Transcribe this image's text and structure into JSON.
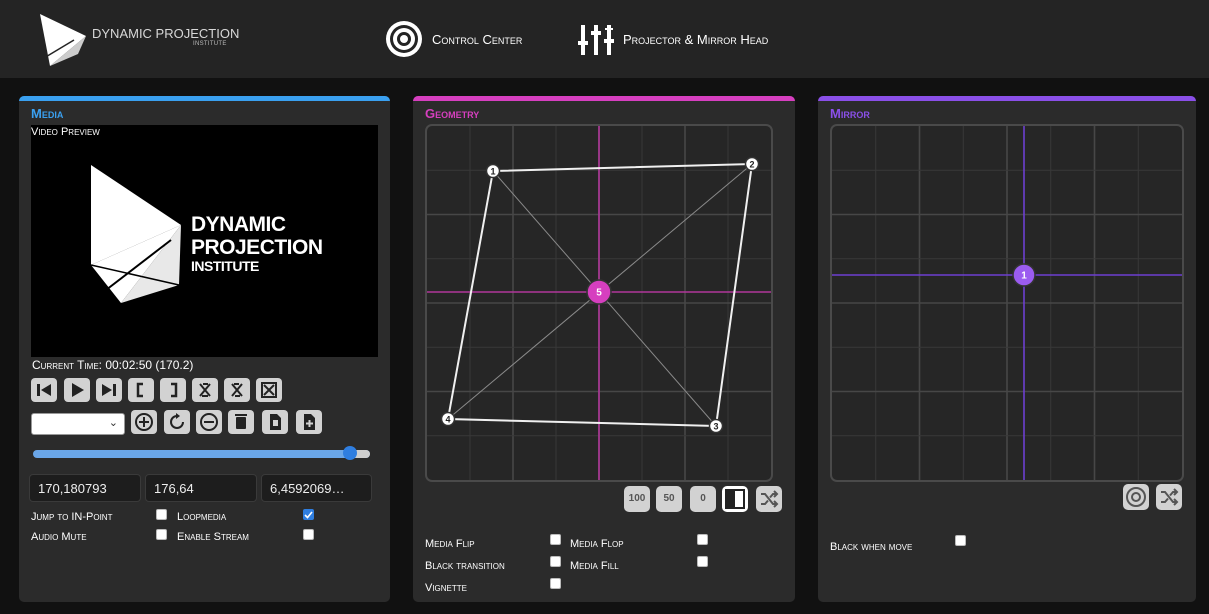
{
  "header": {
    "logo_text": "DYNAMIC PROJECTION",
    "logo_subtext": "INSTITUTE",
    "nav": [
      {
        "label": "Control Center",
        "icon": "target-icon"
      },
      {
        "label": "Projector & Mirror Head",
        "icon": "sliders-icon"
      }
    ]
  },
  "media": {
    "title": "Media",
    "accent": "#3aa0f0",
    "video_preview_label": "Video Preview",
    "preview_text": {
      "line1": "DYNAMIC",
      "line2": "PROJECTION",
      "line3": "INSTITUTE"
    },
    "current_time_label": "Current Time: 00:02:50 (170.2)",
    "playback_buttons": [
      "skip-back-icon",
      "play-icon",
      "skip-forward-icon",
      "in-point-icon",
      "out-point-icon",
      "clear-in-icon",
      "clear-out-icon",
      "clear-all-icon"
    ],
    "playlist_buttons": [
      "add-icon",
      "reload-icon",
      "remove-icon",
      "trash-icon",
      "file-icon",
      "file-add-icon"
    ],
    "select_value": "",
    "progress": 0.94,
    "fields": [
      "170,180793",
      "176,64",
      "6,4592069…"
    ],
    "options": [
      {
        "label": "Jump to IN-Point",
        "checked": false
      },
      {
        "label": "Loopmedia",
        "checked": true
      },
      {
        "label": "Audio Mute",
        "checked": false
      },
      {
        "label": "Enable Stream",
        "checked": false
      }
    ]
  },
  "geometry": {
    "title": "Geometry",
    "accent": "#d63fbf",
    "points": [
      {
        "label": "1"
      },
      {
        "label": "2"
      },
      {
        "label": "3"
      },
      {
        "label": "4"
      },
      {
        "label": "5"
      }
    ],
    "buttons": [
      "100",
      "50",
      "0"
    ],
    "extra_buttons": [
      "contrast-icon",
      "shuffle-icon"
    ],
    "options": [
      {
        "label": "Media Flip",
        "checked": false
      },
      {
        "label": "Media Flop",
        "checked": false
      },
      {
        "label": "Black transition",
        "checked": false
      },
      {
        "label": "Media Fill",
        "checked": false
      },
      {
        "label": "Vignette",
        "checked": false
      }
    ]
  },
  "mirror": {
    "title": "Mirror",
    "accent": "#8a4fe8",
    "point_label": "1",
    "buttons": [
      "target-icon",
      "shuffle-icon"
    ],
    "options": [
      {
        "label": "Black when move",
        "checked": false
      }
    ]
  }
}
